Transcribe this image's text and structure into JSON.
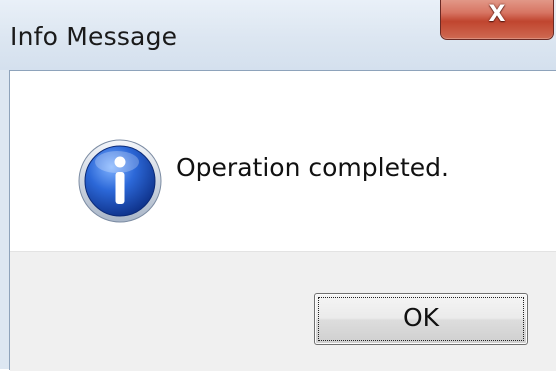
{
  "window": {
    "title": "Info Message",
    "close_icon": "close-icon",
    "close_glyph": "X"
  },
  "message": {
    "icon": "info-icon",
    "text": "Operation completed."
  },
  "buttons": {
    "ok_label": "OK"
  },
  "colors": {
    "close_button": "#c9503b",
    "info_icon_blue": "#1b4fb8",
    "button_bar": "#f0f0f0",
    "titlebar": "#dce6f1"
  }
}
